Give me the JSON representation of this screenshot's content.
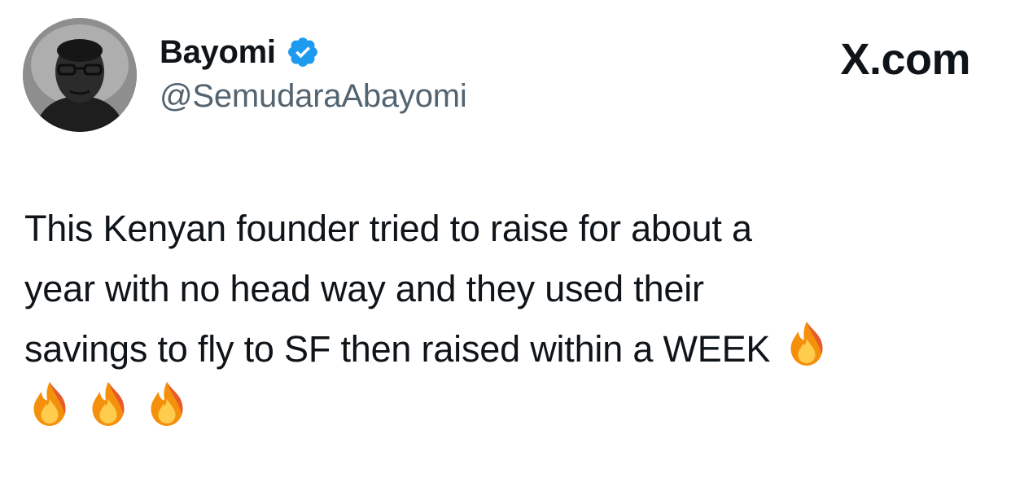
{
  "author": {
    "display_name": "Bayomi",
    "handle": "@SemudaraAbayomi",
    "verified": true,
    "verified_color": "#1d9bf0",
    "avatar_icon": "profile-photo"
  },
  "brand": {
    "label": "X.com"
  },
  "tweet": {
    "lines": [
      "This Kenyan founder tried to raise for about a",
      "year with no head way and they used their",
      "savings to fly to SF then raised within a WEEK"
    ],
    "emoji": [
      "fire",
      "fire",
      "fire",
      "fire"
    ]
  },
  "colors": {
    "text": "#0f1419",
    "secondary_text": "#536471",
    "background": "#ffffff",
    "fire_outer": "#f4900c",
    "fire_inner": "#ffcc4d",
    "fire_edge": "#dd2e44"
  }
}
